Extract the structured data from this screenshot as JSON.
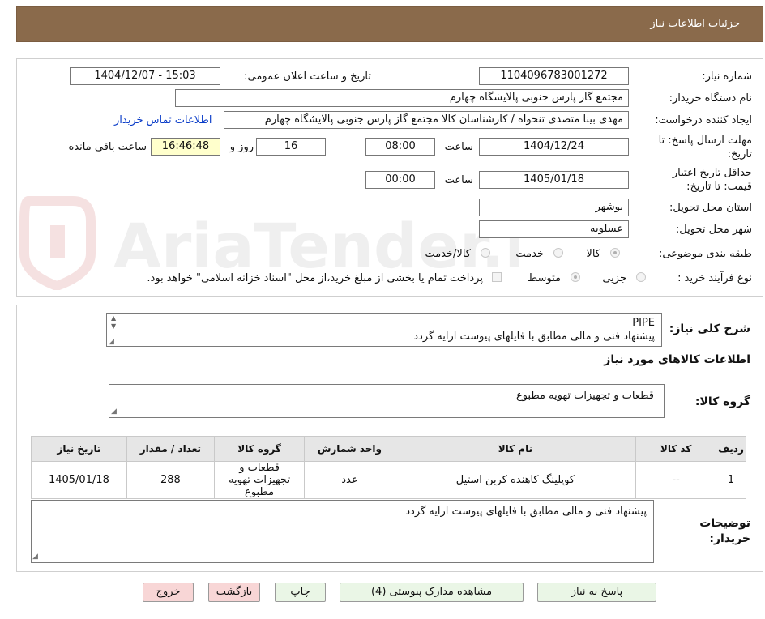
{
  "header": {
    "title": "جزئیات اطلاعات نیاز"
  },
  "colors": {
    "header_bg": "#8a6a4b",
    "button_green": "#eaf6e6",
    "button_pink": "#f8d6d6",
    "remaining_bg": "#ffffcc",
    "link": "#0a3cc8"
  },
  "watermark": {
    "text": "AriaTender.neT"
  },
  "form": {
    "need_number_label": "شماره نیاز:",
    "need_number": "1104096783001272",
    "announce_label": "تاریخ و ساعت اعلان عمومی:",
    "announce_value": "1404/12/07 - 15:03",
    "buyer_org_label": "نام دستگاه خریدار:",
    "buyer_org": "مجتمع گاز پارس جنوبی  پالایشگاه چهارم",
    "creator_label": "ایجاد کننده درخواست:",
    "creator": "مهدی بینا متصدی تنخواه / کارشناسان کالا مجتمع گاز پارس جنوبی  پالایشگاه چهارم",
    "contact_link": "اطلاعات تماس خریدار",
    "deadline_label_1": "مهلت ارسال پاسخ: تا",
    "deadline_label_2": "تاریخ:",
    "deadline_date": "1404/12/24",
    "time_label": "ساعت",
    "deadline_time": "08:00",
    "days_value": "16",
    "days_label": "روز و",
    "remaining_time": "16:46:48",
    "remaining_label": "ساعت باقی مانده",
    "validity_label_1": "حداقل تاریخ اعتبار",
    "validity_label_2": "قیمت: تا تاریخ:",
    "validity_date": "1405/01/18",
    "validity_time_label": "ساعت",
    "validity_time": "00:00",
    "province_label": "استان محل تحویل:",
    "province": "بوشهر",
    "city_label": "شهر محل تحویل:",
    "city": "عسلویه",
    "category_label": "طبقه بندی موضوعی:",
    "category_options": [
      "کالا",
      "خدمت",
      "کالا/خدمت"
    ],
    "process_label": "نوع فرآیند خرید :",
    "process_options": [
      "جزیی",
      "متوسط"
    ],
    "payment_note": "پرداخت تمام یا بخشی از مبلغ خرید،از محل \"اسناد خزانه اسلامی\" خواهد بود."
  },
  "description": {
    "label": "شرح کلی نیاز:",
    "line1": "PIPE",
    "line2": "پیشنهاد فنی و مالی مطابق با فایلهای پیوست ارایه گردد"
  },
  "goods": {
    "section_title": "اطلاعات کالاهای مورد نیاز",
    "group_label": "گروه کالا:",
    "group_value": "قطعات و تجهیزات تهویه مطبوع"
  },
  "table": {
    "headers": [
      "ردیف",
      "کد کالا",
      "نام کالا",
      "واحد شمارش",
      "گروه کالا",
      "تعداد / مقدار",
      "تاریخ نیاز"
    ],
    "rows": [
      {
        "row": "1",
        "code": "--",
        "name": "کوپلینگ کاهنده کربن استیل",
        "unit": "عدد",
        "group": "قطعات و تجهیزات تهویه مطبوع",
        "qty": "288",
        "date": "1405/01/18"
      }
    ]
  },
  "buyer_notes": {
    "label_1": "توضیحات",
    "label_2": "خریدار:",
    "text": "پیشنهاد فنی و مالی مطابق با فایلهای پیوست ارایه گردد"
  },
  "buttons": {
    "reply": "پاسخ به نیاز",
    "attachments": "مشاهده مدارک پیوستی (4)",
    "print": "چاپ",
    "back": "بازگشت",
    "exit": "خروج"
  }
}
